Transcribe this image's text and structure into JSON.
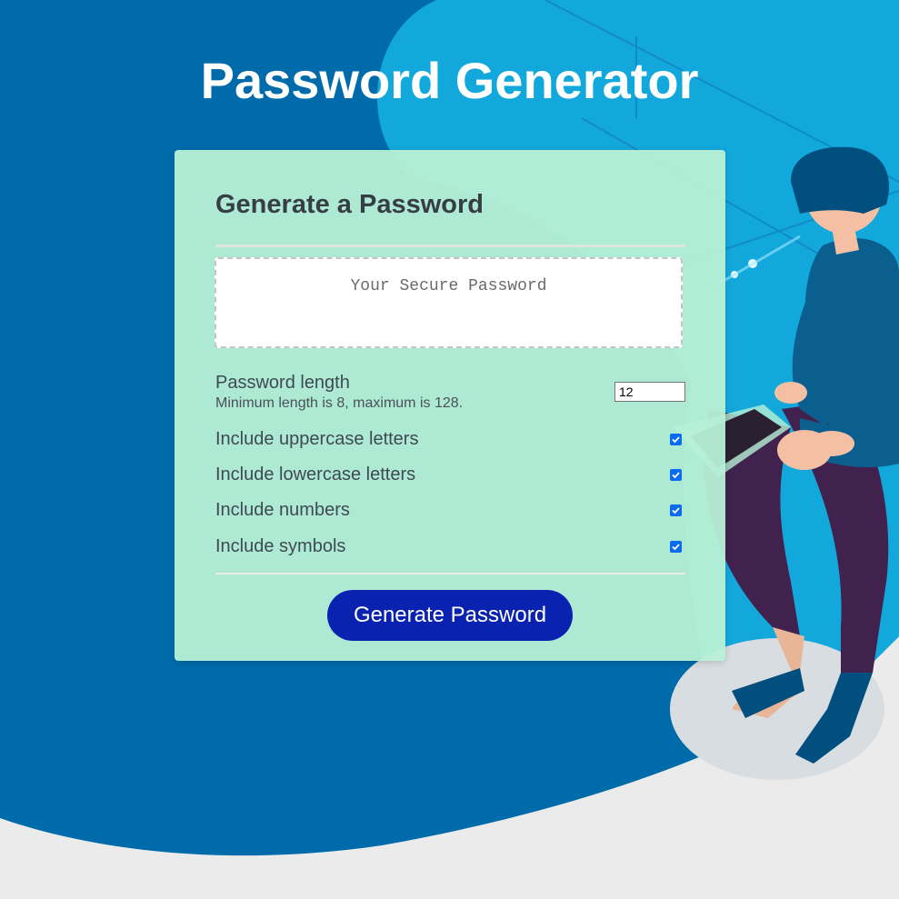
{
  "page": {
    "title": "Password Generator"
  },
  "card": {
    "heading": "Generate a Password",
    "password_placeholder": "Your Secure Password"
  },
  "options": {
    "length_label": "Password length",
    "length_hint": "Minimum length is 8, maximum is 128.",
    "length_value": "12",
    "checkboxes": [
      {
        "label": "Include uppercase letters",
        "checked": true
      },
      {
        "label": "Include lowercase letters",
        "checked": true
      },
      {
        "label": "Include numbers",
        "checked": true
      },
      {
        "label": "Include symbols",
        "checked": true
      }
    ]
  },
  "actions": {
    "generate_label": "Generate Password"
  },
  "colors": {
    "background_dark": "#006bab",
    "background_light": "#13a8dc",
    "card": "#b7f0d6",
    "button": "#0a22b0",
    "checkbox": "#0a6cf0"
  }
}
